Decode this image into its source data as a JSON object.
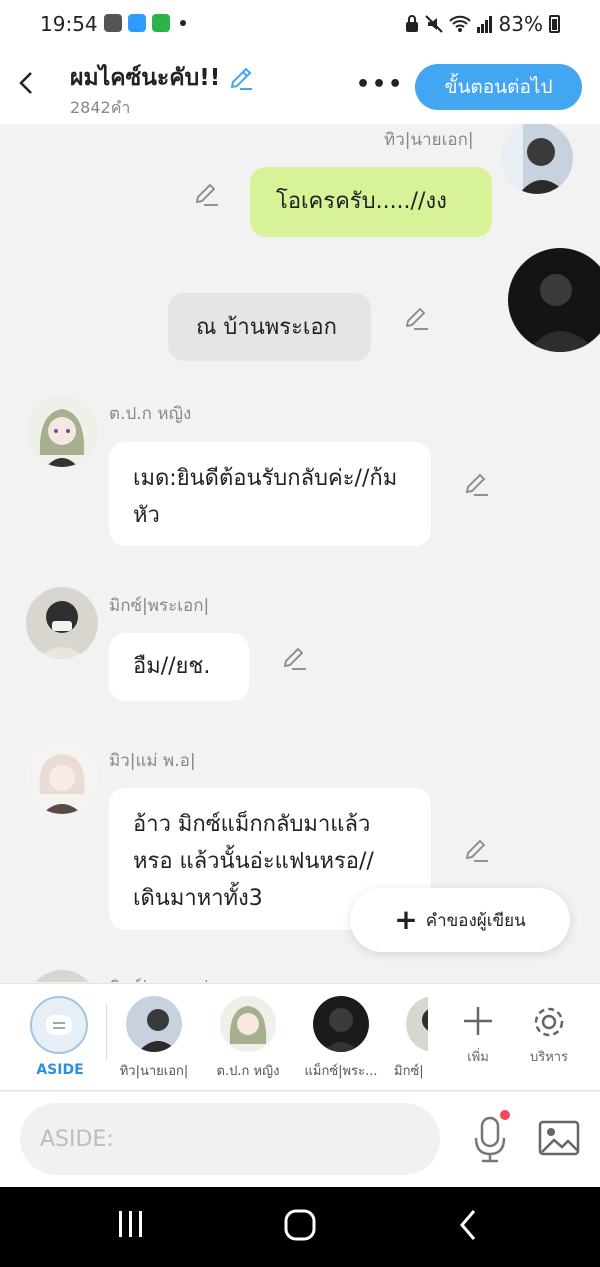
{
  "status_bar": {
    "time": "19:54",
    "battery": "83%",
    "apps": [
      {
        "label": "▣",
        "color": "#555555"
      },
      {
        "label": "WEB",
        "color": "#2f9bff"
      },
      {
        "label": "LINE",
        "color": "#2bb34a"
      }
    ]
  },
  "header": {
    "title": "ผมไคซ์นะคับ!!",
    "word_count": "2842คำ",
    "more": "•••",
    "next_button": "ขั้นตอนต่อไป"
  },
  "chat": {
    "messages": [
      {
        "sender": "ทิว|นายเอก|",
        "text": "โอเครครับ.....//งง"
      },
      {
        "text": "ณ บ้านพระเอก"
      },
      {
        "sender": "ต.ป.ก หญิง",
        "text": "เมด:ยินดีต้อนรับกลับค่ะ//ก้มหัว"
      },
      {
        "sender": "มิกซ์|พระเอก|",
        "text": "อืม//ยช."
      },
      {
        "sender": "มิว|แม่ พ.อ|",
        "text": "อ้าว มิกซ์แม็กกลับมาแล้วหรอ แล้วนั้นอ่ะแฟนหรอ//เดินมาหาทั้ง3"
      },
      {
        "sender": "มิกซ์|พระเอก|"
      }
    ],
    "writer_button": "คำของผู้เขียน",
    "writer_plus": "+"
  },
  "characters": [
    {
      "label": "ASIDE"
    },
    {
      "label": "ทิว|นายเอก|"
    },
    {
      "label": "ต.ป.ก หญิง"
    },
    {
      "label": "แม็กซ์|พระ..."
    },
    {
      "label": "มิกซ์|"
    }
  ],
  "tools": {
    "add": "เพิ่ม",
    "manage": "บริหาร"
  },
  "input": {
    "placeholder": "ASIDE:"
  },
  "colors": {
    "accent": "#42a6f2",
    "green_bubble": "#d7f297"
  }
}
